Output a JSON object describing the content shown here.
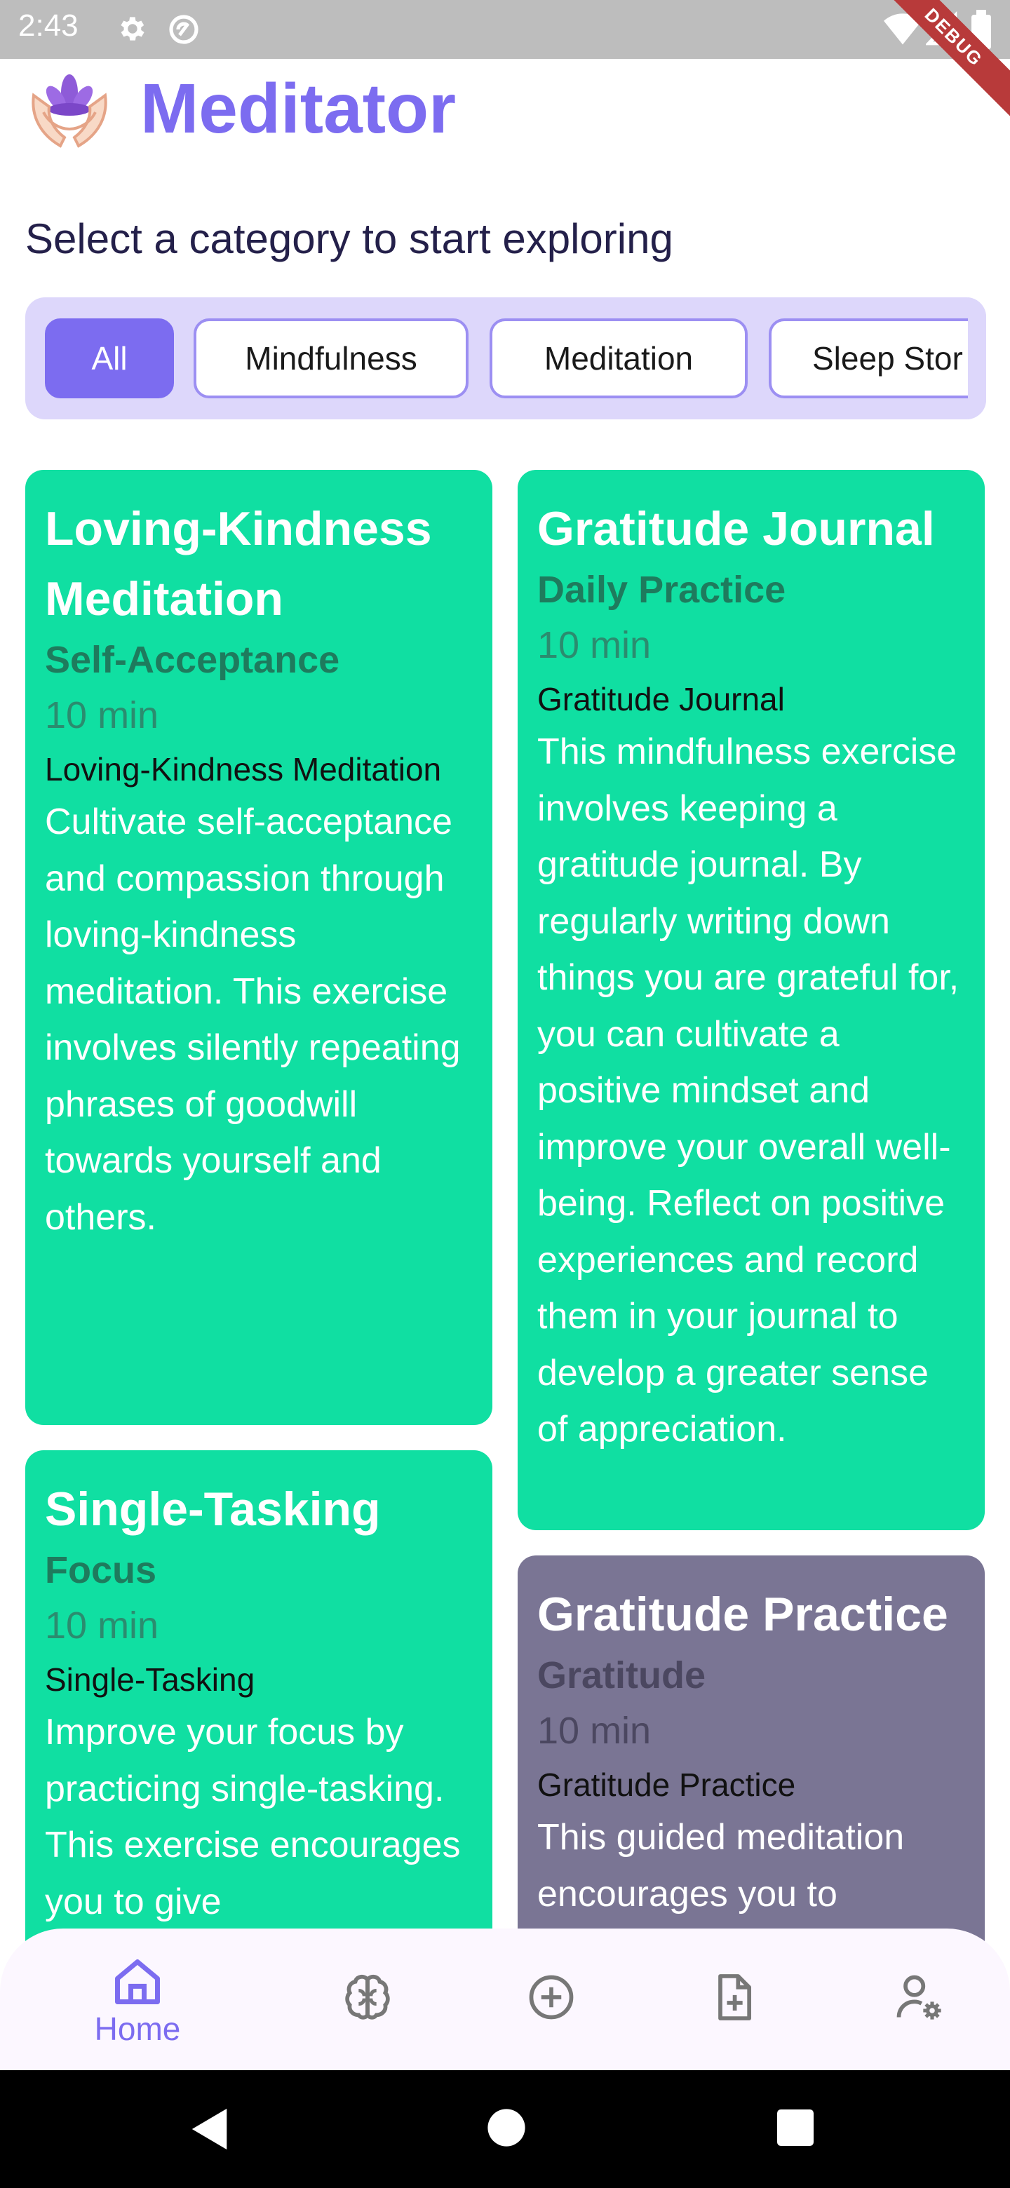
{
  "status_bar": {
    "time": "2:43",
    "debug_label": "DEBUG"
  },
  "header": {
    "title": "Meditator",
    "logo_icon": "lotus-hands-icon"
  },
  "subtitle": "Select a category to start exploring",
  "categories": [
    {
      "label": "All",
      "selected": true
    },
    {
      "label": "Mindfulness",
      "selected": false
    },
    {
      "label": "Meditation",
      "selected": false
    },
    {
      "label": "Sleep Stor",
      "selected": false
    }
  ],
  "cards": [
    {
      "title": "Loving-Kindness Meditation",
      "category": "Self-Acceptance",
      "duration": "10 min",
      "name": "Loving-Kindness Meditation",
      "description": "Cultivate self-acceptance and compassion through loving-kindness meditation. This exercise involves silently repeating phrases of goodwill towards yourself and others.",
      "color": "#10dfa2"
    },
    {
      "title": "Gratitude Journal",
      "category": "Daily Practice",
      "duration": "10 min",
      "name": "Gratitude Journal",
      "description": "This mindfulness exercise involves keeping a gratitude journal. By regularly writing down things you are grateful for, you can cultivate a positive mindset and improve your overall well-being. Reflect on positive experiences and record them in your journal to develop a greater sense of appreciation.",
      "color": "#10dfa2"
    },
    {
      "title": "Single-Tasking",
      "category": "Focus",
      "duration": "10 min",
      "name": "Single-Tasking",
      "description": "Improve your focus by practicing single-tasking. This exercise encourages you to give",
      "color": "#10dfa2"
    },
    {
      "title": "Gratitude Practice",
      "category": "Gratitude",
      "duration": "10 min",
      "name": "Gratitude Practice",
      "description": "This guided meditation encourages you to",
      "color": "#7a7594"
    }
  ],
  "bottom_nav": [
    {
      "label": "Home",
      "icon": "home-icon",
      "active": true
    },
    {
      "label": "",
      "icon": "brain-icon",
      "active": false
    },
    {
      "label": "",
      "icon": "add-circle-icon",
      "active": false
    },
    {
      "label": "",
      "icon": "add-document-icon",
      "active": false
    },
    {
      "label": "",
      "icon": "user-settings-icon",
      "active": false
    }
  ],
  "colors": {
    "accent": "#7c6cf0",
    "card_green": "#10dfa2",
    "card_purple": "#7a7594",
    "chip_bar": "#ddd7fb"
  }
}
